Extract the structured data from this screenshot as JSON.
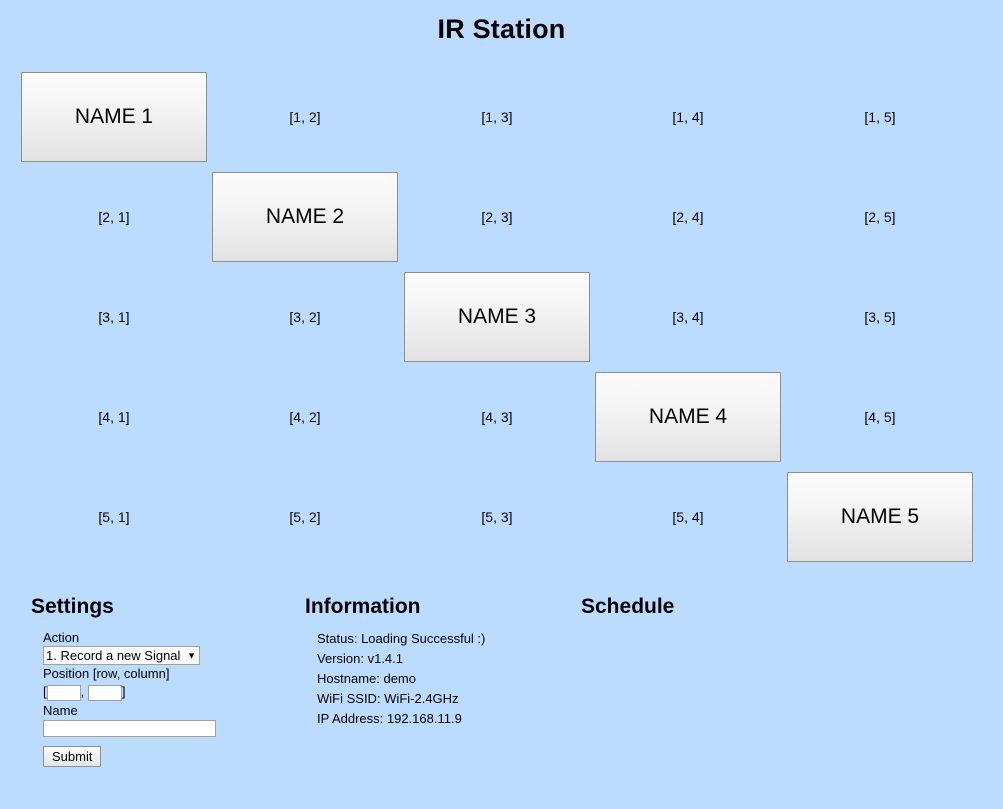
{
  "app": {
    "title": "IR Station",
    "background_color": "#bcdcff"
  },
  "grid": {
    "rows": 5,
    "columns": 5,
    "cells": [
      {
        "row": 1,
        "column": 1,
        "type": "button",
        "label": "NAME 1"
      },
      {
        "row": 1,
        "column": 2,
        "type": "empty",
        "label": "[1, 2]"
      },
      {
        "row": 1,
        "column": 3,
        "type": "empty",
        "label": "[1, 3]"
      },
      {
        "row": 1,
        "column": 4,
        "type": "empty",
        "label": "[1, 4]"
      },
      {
        "row": 1,
        "column": 5,
        "type": "empty",
        "label": "[1, 5]"
      },
      {
        "row": 2,
        "column": 1,
        "type": "empty",
        "label": "[2, 1]"
      },
      {
        "row": 2,
        "column": 2,
        "type": "button",
        "label": "NAME 2"
      },
      {
        "row": 2,
        "column": 3,
        "type": "empty",
        "label": "[2, 3]"
      },
      {
        "row": 2,
        "column": 4,
        "type": "empty",
        "label": "[2, 4]"
      },
      {
        "row": 2,
        "column": 5,
        "type": "empty",
        "label": "[2, 5]"
      },
      {
        "row": 3,
        "column": 1,
        "type": "empty",
        "label": "[3, 1]"
      },
      {
        "row": 3,
        "column": 2,
        "type": "empty",
        "label": "[3, 2]"
      },
      {
        "row": 3,
        "column": 3,
        "type": "button",
        "label": "NAME 3"
      },
      {
        "row": 3,
        "column": 4,
        "type": "empty",
        "label": "[3, 4]"
      },
      {
        "row": 3,
        "column": 5,
        "type": "empty",
        "label": "[3, 5]"
      },
      {
        "row": 4,
        "column": 1,
        "type": "empty",
        "label": "[4, 1]"
      },
      {
        "row": 4,
        "column": 2,
        "type": "empty",
        "label": "[4, 2]"
      },
      {
        "row": 4,
        "column": 3,
        "type": "empty",
        "label": "[4, 3]"
      },
      {
        "row": 4,
        "column": 4,
        "type": "button",
        "label": "NAME 4"
      },
      {
        "row": 4,
        "column": 5,
        "type": "empty",
        "label": "[4, 5]"
      },
      {
        "row": 5,
        "column": 1,
        "type": "empty",
        "label": "[5, 1]"
      },
      {
        "row": 5,
        "column": 2,
        "type": "empty",
        "label": "[5, 2]"
      },
      {
        "row": 5,
        "column": 3,
        "type": "empty",
        "label": "[5, 3]"
      },
      {
        "row": 5,
        "column": 4,
        "type": "empty",
        "label": "[5, 4]"
      },
      {
        "row": 5,
        "column": 5,
        "type": "button",
        "label": "NAME 5"
      }
    ]
  },
  "settings": {
    "heading": "Settings",
    "action": {
      "label": "Action",
      "selected": "1. Record a new Signal",
      "arrow_icon": "▼"
    },
    "position": {
      "label": "Position [row, column]",
      "open_bracket": "[",
      "separator": ",",
      "close_bracket": "]",
      "row_value": "",
      "column_value": ""
    },
    "name": {
      "label": "Name",
      "value": ""
    },
    "submit_label": "Submit"
  },
  "information": {
    "heading": "Information",
    "items": [
      "Status: Loading Successful :)",
      "Version: v1.4.1",
      "Hostname: demo",
      "WiFi SSID: WiFi-2.4GHz",
      "IP Address: 192.168.11.9"
    ]
  },
  "schedule": {
    "heading": "Schedule",
    "items": []
  }
}
